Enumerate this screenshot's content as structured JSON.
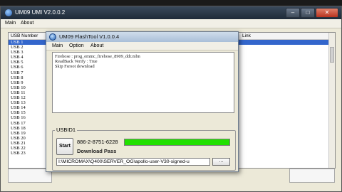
{
  "back_window": {
    "title": "UM09 UMI V2.0.0.2",
    "menu": [
      "Main",
      "About"
    ],
    "columns": [
      "USB Number",
      "Link"
    ],
    "rows": [
      "USB 1",
      "USB 2",
      "USB 3",
      "USB 4",
      "USB 5",
      "USB 6",
      "USB 7",
      "USB 8",
      "USB 9",
      "USB 10",
      "USB 11",
      "USB 12",
      "USB 13",
      "USB 14",
      "USB 15",
      "USB 16",
      "USB 17",
      "USB 18",
      "USB 19",
      "USB 20",
      "USB 21",
      "USB 22",
      "USB 23"
    ],
    "selected_row": 0
  },
  "front_window": {
    "title": "UM09 FlashTool V1.0.0.4",
    "menu": [
      "Main",
      "Option",
      "About"
    ],
    "log_lines": [
      "Firehose : prog_emmc_firehose_8909_ddr.mbn",
      "ReadBack Verify : True",
      "Skip Fsroot download"
    ],
    "group_label": "USBID1",
    "start_label": "Start",
    "device_id": "886-2-8751-6228",
    "status": "Download Pass",
    "progress_percent": 100,
    "progress_color": "#22e000",
    "path": "I:\\MICROMAX\\Q400\\SERVER_OG\\apollo-user-V30-signed-u",
    "browse_label": "..."
  },
  "colors": {
    "selection": "#3366cc",
    "titlebar_back": "#2a3748"
  }
}
